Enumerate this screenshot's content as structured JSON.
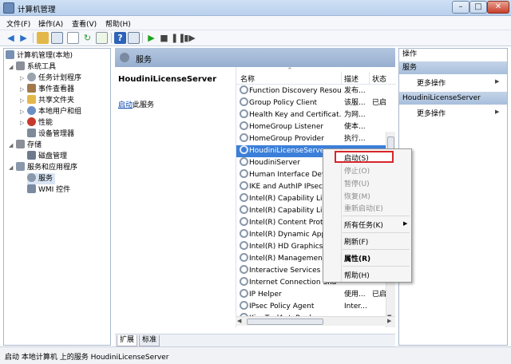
{
  "window": {
    "title": "计算机管理",
    "min": "–",
    "max": "□",
    "close": "✕"
  },
  "menu": [
    "文件(F)",
    "操作(A)",
    "查看(V)",
    "帮助(H)"
  ],
  "toolbar": {
    "icons": [
      "back-arrow-icon",
      "forward-arrow-icon",
      "up-folder-icon",
      "console-tree-icon",
      "properties-icon",
      "refresh-icon",
      "export-icon",
      "help-icon",
      "console-icon",
      "play-icon",
      "stop-icon",
      "pause-icon",
      "restart-icon"
    ],
    "colors": {
      "play": "#1aa31a",
      "stop": "#444444"
    }
  },
  "tree": {
    "root": "计算机管理(本地)",
    "system_tools": "系统工具",
    "task_scheduler": "任务计划程序",
    "event_viewer": "事件查看器",
    "shared_folders": "共享文件夹",
    "local_users": "本地用户和组",
    "performance": "性能",
    "device_manager": "设备管理器",
    "storage": "存储",
    "disk_management": "磁盘管理",
    "services_apps": "服务和应用程序",
    "services": "服务",
    "wmi": "WMI 控件"
  },
  "main": {
    "header": "服务",
    "selected_service": "HoudiniLicenseServer",
    "start_link": "启动",
    "start_link_suffix": "此服务",
    "columns": {
      "name": "名称",
      "desc": "描述",
      "status": "状态"
    },
    "sort_indicator": "^",
    "rows": [
      {
        "name": "Function Discovery Resou...",
        "desc": "发布...",
        "status": ""
      },
      {
        "name": "Group Policy Client",
        "desc": "该服...",
        "status": "已启"
      },
      {
        "name": "Health Key and Certificat...",
        "desc": "为网...",
        "status": ""
      },
      {
        "name": "HomeGroup Listener",
        "desc": "使本...",
        "status": ""
      },
      {
        "name": "HomeGroup Provider",
        "desc": "执行...",
        "status": ""
      },
      {
        "name": "HoudiniLicenseServer",
        "desc": "",
        "status": ""
      },
      {
        "name": "HoudiniServer",
        "desc": "",
        "status": ""
      },
      {
        "name": "Human Interface Devic",
        "desc": "",
        "status": ""
      },
      {
        "name": "IKE and AuthIP IPsec K",
        "desc": "",
        "status": ""
      },
      {
        "name": "Intel(R) Capability Licer",
        "desc": "",
        "status": ""
      },
      {
        "name": "Intel(R) Capability Licer",
        "desc": "",
        "status": ""
      },
      {
        "name": "Intel(R) Content Protect",
        "desc": "",
        "status": ""
      },
      {
        "name": "Intel(R) Dynamic Applic",
        "desc": "",
        "status": ""
      },
      {
        "name": "Intel(R) HD Graphics Co",
        "desc": "",
        "status": ""
      },
      {
        "name": "Intel(R) Management a",
        "desc": "",
        "status": ""
      },
      {
        "name": "Interactive Services De",
        "desc": "",
        "status": ""
      },
      {
        "name": "Internet Connection Sha",
        "desc": "",
        "status": ""
      },
      {
        "name": "IP Helper",
        "desc": "使用...",
        "status": "已启"
      },
      {
        "name": "IPsec Policy Agent",
        "desc": "Inter...",
        "status": ""
      },
      {
        "name": "KingToolAutoRank",
        "desc": "",
        "status": ""
      }
    ],
    "tabs": [
      "扩展",
      "标准"
    ]
  },
  "actions": {
    "title": "操作",
    "section1": "服务",
    "more1": "更多操作",
    "section2": "HoudiniLicenseServer",
    "more2": "更多操作"
  },
  "context_menu": {
    "start": "启动(S)",
    "stop": "停止(O)",
    "pause": "暂停(U)",
    "resume": "恢复(M)",
    "restart": "重新启动(E)",
    "all_tasks": "所有任务(K)",
    "refresh": "刷新(F)",
    "properties": "属性(R)",
    "help": "帮助(H)",
    "highlight_color": "#d7252a"
  },
  "status_bar": "启动 本地计算机 上的服务 HoudiniLicenseServer"
}
